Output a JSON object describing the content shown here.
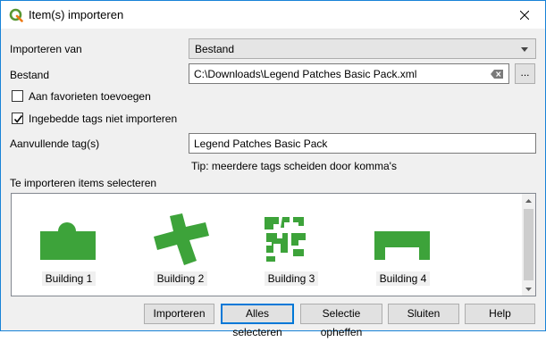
{
  "window": {
    "title": "Item(s) importeren",
    "app_icon": "qgis-icon"
  },
  "form": {
    "import_from_label": "Importeren van",
    "import_from_value": "Bestand",
    "file_label": "Bestand",
    "file_value": "C:\\Downloads\\Legend Patches Basic Pack.xml",
    "browse_label": "...",
    "add_favorites_label": "Aan favorieten toevoegen",
    "add_favorites_checked": false,
    "ignore_tags_label": "Ingebedde tags niet importeren",
    "ignore_tags_checked": true,
    "additional_tags_label": "Aanvullende tag(s)",
    "additional_tags_value": "Legend Patches Basic Pack",
    "tip": "Tip: meerdere tags scheiden door komma's"
  },
  "items_section": {
    "title": "Te importeren items selecteren",
    "items": [
      {
        "label": "Building 1",
        "icon": "building-shape-1"
      },
      {
        "label": "Building 2",
        "icon": "building-shape-2"
      },
      {
        "label": "Building 3",
        "icon": "building-shape-3"
      },
      {
        "label": "Building 4",
        "icon": "building-shape-4"
      }
    ],
    "patch_color": "#3da33a"
  },
  "buttons": {
    "import": "Importeren",
    "select_all": "Alles selecteren",
    "deselect": "Selectie opheffen",
    "close": "Sluiten",
    "help": "Help"
  }
}
